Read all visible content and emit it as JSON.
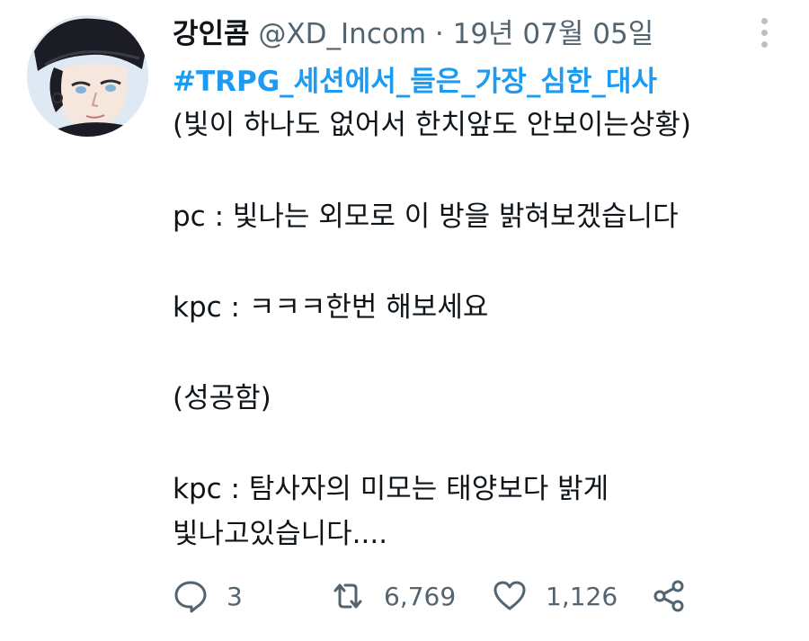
{
  "tweet": {
    "author_name": "강인콤",
    "handle": "@XD_Incom",
    "separator": "·",
    "date": "19년 07월 05일",
    "hashtag": "#TRPG_세션에서_들은_가장_심한_대사",
    "lines": [
      "(빛이 하나도 없어서 한치앞도 안보이는상황)",
      "",
      "pc : 빛나는 외모로 이 방을 밝혀보겠습니다",
      "",
      "kpc : ㅋㅋㅋ한번 해보세요",
      "",
      "(성공함)",
      "",
      "kpc : 탐사자의 미모는 태양보다 밝게",
      "빛나고있습니다...."
    ]
  },
  "actions": {
    "reply": {
      "icon": "reply-icon",
      "count": "3"
    },
    "retweet": {
      "icon": "retweet-icon",
      "count": "6,769"
    },
    "like": {
      "icon": "heart-icon",
      "count": "1,126"
    },
    "share": {
      "icon": "share-icon"
    }
  },
  "colors": {
    "text": "#0f1419",
    "secondary": "#536471",
    "hashtag": "#1d9bf0",
    "background": "#ffffff"
  }
}
